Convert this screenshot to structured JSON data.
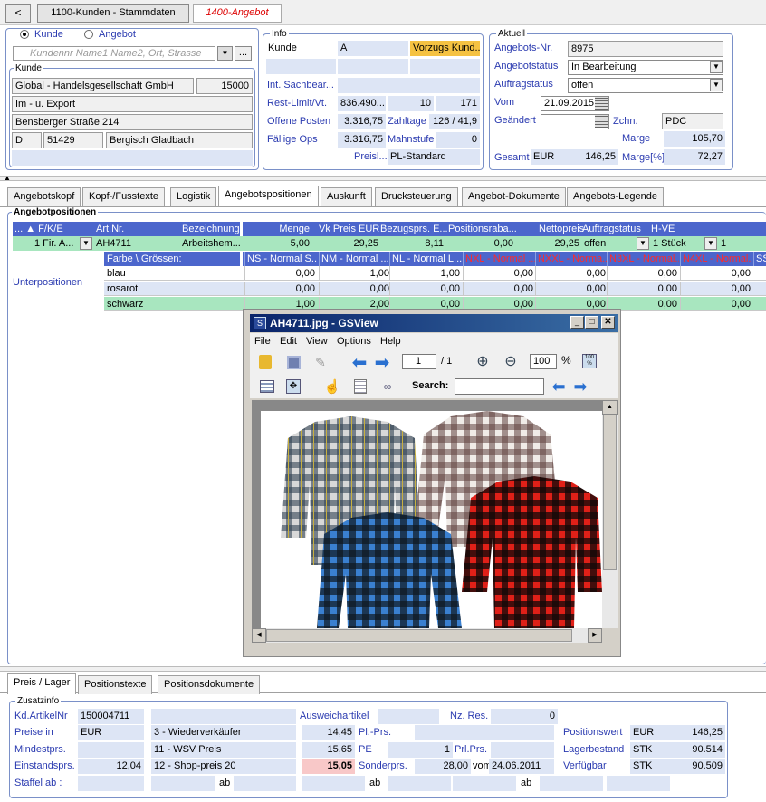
{
  "topbar": {
    "back": "<",
    "tab1": "1100-Kunden - Stammdaten",
    "tab2": "1400-Angebot"
  },
  "kunde_panel": {
    "radio_kunde": "Kunde",
    "radio_angebot": "Angebot",
    "search_placeholder": "Kundennr Name1 Name2, Ort, Strasse",
    "group_title": "Kunde",
    "name": "Global - Handelsgesellschaft GmbH",
    "nr": "15000",
    "line2": "Im - u. Export",
    "street": "Bensberger Straße 214",
    "country": "D",
    "zip": "51429",
    "city": "Bergisch Gladbach"
  },
  "info": {
    "title": "Info",
    "kunde_label": "Kunde",
    "kunde_value": "A",
    "vorzug": "Vorzugs Kund...",
    "sachbear_label": "Int. Sachbear...",
    "restlimit_label": "Rest-Limit/Vt.",
    "restlimit_value": "836.490...",
    "restlimit_v2": "10",
    "restlimit_v3": "171",
    "offene_label": "Offene Posten",
    "offene_value": "3.316,75",
    "zahltage_label": "Zahltage",
    "zahltage_value": "126 / 41,9",
    "faellig_label": "Fällige Ops",
    "faellig_value": "3.316,75",
    "mahn_label": "Mahnstufe",
    "mahn_value": "0",
    "preisl_label": "Preisl...",
    "preisl_value": "PL-Standard"
  },
  "aktuell": {
    "title": "Aktuell",
    "nr_label": "Angebots-Nr.",
    "nr_value": "8975",
    "status_label": "Angebotstatus",
    "status_value": "In Bearbeitung",
    "auftrag_label": "Auftragstatus",
    "auftrag_value": "offen",
    "vom_label": "Vom",
    "vom_value": "21.09.2015",
    "geaendert_label": "Geändert",
    "zchn_label": "Zchn.",
    "zchn_value": "PDC",
    "marge_label": "Marge",
    "marge_value": "105,70",
    "gesamt_label": "Gesamt",
    "gesamt_cur": "EUR",
    "gesamt_value": "146,25",
    "margep_label": "Marge[%]",
    "margep_value": "72,27"
  },
  "tabs": [
    "Angebotskopf",
    "Kopf-/Fusstexte",
    "Logistik",
    "Angebotspositionen",
    "Auskunft",
    "Drucksteuerung",
    "Angebot-Dokumente",
    "Angebots-Legende"
  ],
  "positions": {
    "title": "Angebotpositionen",
    "headers": {
      "fke": "... ▲ F/K/E",
      "artnr": "Art.Nr.",
      "bez": "Bezeichnung",
      "menge": "Menge",
      "vk": "Vk Preis EUR",
      "bez_prs": "Bezugsprs. E...",
      "rabatt": "Positionsraba...",
      "netto": "Nettopreis",
      "status": "Auftragstatus",
      "hve": "H-VE"
    },
    "row": {
      "fke": "1 Fir. A...",
      "artnr": "AH4711",
      "bez": "Arbeitshem...",
      "menge": "5,00",
      "vk": "29,25",
      "bez_prs": "8,11",
      "rabatt": "0,00",
      "netto": "29,25",
      "status": "offen",
      "hve": "1 Stück",
      "hve2": "1"
    },
    "unterpositionen": "Unterpositionen",
    "farbe_header": "Farbe \\ Grössen:",
    "size_headers": [
      "NS - Normal S...",
      "NM - Normal ...",
      "NL - Normal L...",
      "NXL - Normal ...",
      "NXXL - Norma...",
      "N3XL - Normal...",
      "N4XL - Normal...",
      "SS"
    ],
    "colors": [
      {
        "name": "blau",
        "values": [
          "0,00",
          "1,00",
          "1,00",
          "0,00",
          "0,00",
          "0,00",
          "0,00"
        ]
      },
      {
        "name": "rosarot",
        "values": [
          "0,00",
          "0,00",
          "0,00",
          "0,00",
          "0,00",
          "0,00",
          "0,00"
        ]
      },
      {
        "name": "schwarz",
        "values": [
          "1,00",
          "2,00",
          "0,00",
          "0,00",
          "0,00",
          "0,00",
          "0,00"
        ]
      }
    ]
  },
  "viewer": {
    "title": "AH4711.jpg - GSView",
    "menu": [
      "File",
      "Edit",
      "View",
      "Options",
      "Help"
    ],
    "page": "1",
    "pages": "/ 1",
    "zoom": "100",
    "pct": "%",
    "search_label": "Search:"
  },
  "bottom_tabs": [
    "Preis / Lager",
    "Positionstexte",
    "Positionsdokumente"
  ],
  "zusatz": {
    "title": "Zusatzinfo",
    "kdart_label": "Kd.ArtikelNr",
    "kdart_value": "150004711",
    "ausweich_label": "Ausweichartikel",
    "nzres_label": "Nz. Res.",
    "nzres_value": "0",
    "preise_label": "Preise in",
    "preise_value": "EUR",
    "p3_label": "3 - Wiederverkäufer",
    "p3_value": "14,45",
    "plprs_label": "Pl.-Prs.",
    "poswert_label": "Positionswert",
    "poswert_cur": "EUR",
    "poswert_value": "146,25",
    "mindest_label": "Mindestprs.",
    "p11_label": "11 - WSV Preis",
    "p11_value": "15,65",
    "pe_label": "PE",
    "pe_value": "1",
    "prlprs_label": "Prl.Prs.",
    "lager_label": "Lagerbestand",
    "lager_unit": "STK",
    "lager_value": "90.514",
    "einstand_label": "Einstandsprs.",
    "einstand_value": "12,04",
    "p12_label": "12 - Shop-preis 20",
    "p12_value": "15,05",
    "sonder_label": "Sonderprs.",
    "sonder_value": "28,00",
    "vom_label": "vom",
    "vom_value": "24.06.2011",
    "verf_label": "Verfügbar",
    "verf_unit": "STK",
    "verf_value": "90.509",
    "staffel_label": "Staffel ab :",
    "ab1": "ab",
    "ab2": "ab",
    "ab3": "ab"
  }
}
